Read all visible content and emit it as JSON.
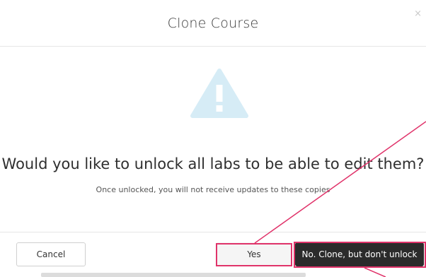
{
  "modal": {
    "title": "Clone Course",
    "close_glyph": "×",
    "icon": "warning-triangle-icon",
    "question": "Would you like to unlock all labs to be able to edit them?",
    "subtext": "Once unlocked, you will not receive updates to these copies"
  },
  "footer": {
    "cancel_label": "Cancel",
    "yes_label": "Yes",
    "no_label": "No. Clone, but don't unlock"
  },
  "colors": {
    "highlight": "#e0336a",
    "warning_icon": "#d6ecf6",
    "primary_dark": "#2b2b2b"
  }
}
